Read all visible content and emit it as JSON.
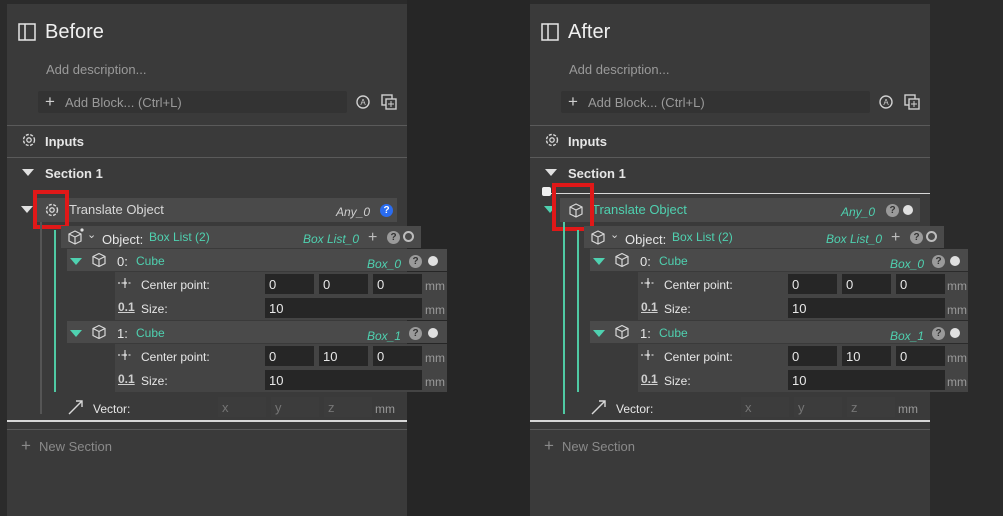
{
  "before": {
    "title": "Before",
    "description_placeholder": "Add description...",
    "add_block": "Add Block... (Ctrl+L)",
    "inputs": "Inputs",
    "section": "Section 1",
    "block_name": "Translate Object",
    "block_type": "Any_0",
    "object_label": "Object:",
    "object_value": "Box List (2)",
    "object_type": "Box List_0",
    "items": [
      {
        "index": "0:",
        "name": "Cube",
        "type": "Box_0",
        "center_label": "Center point:",
        "center": [
          "0",
          "0",
          "0"
        ],
        "size_label": "Size:",
        "size": "10",
        "unit": "mm"
      },
      {
        "index": "1:",
        "name": "Cube",
        "type": "Box_1",
        "center_label": "Center point:",
        "center": [
          "0",
          "10",
          "0"
        ],
        "size_label": "Size:",
        "size": "10",
        "unit": "mm"
      }
    ],
    "vector_label": "Vector:",
    "vector_placeholders": [
      "x",
      "y",
      "z"
    ],
    "vector_unit": "mm",
    "new_section": "New Section"
  },
  "after": {
    "title": "After",
    "description_placeholder": "Add description...",
    "add_block": "Add Block... (Ctrl+L)",
    "inputs": "Inputs",
    "section": "Section 1",
    "block_name": "Translate Object",
    "block_type": "Any_0",
    "object_label": "Object:",
    "object_value": "Box List (2)",
    "object_type": "Box List_0",
    "items": [
      {
        "index": "0:",
        "name": "Cube",
        "type": "Box_0",
        "center_label": "Center point:",
        "center": [
          "0",
          "0",
          "0"
        ],
        "size_label": "Size:",
        "size": "10",
        "unit": "mm"
      },
      {
        "index": "1:",
        "name": "Cube",
        "type": "Box_1",
        "center_label": "Center point:",
        "center": [
          "0",
          "10",
          "0"
        ],
        "size_label": "Size:",
        "size": "10",
        "unit": "mm"
      }
    ],
    "vector_label": "Vector:",
    "vector_placeholders": [
      "x",
      "y",
      "z"
    ],
    "vector_unit": "mm",
    "new_section": "New Section"
  },
  "colors": {
    "accent": "#4fd1b0",
    "highlight": "#e01818",
    "info": "#2a6cf0"
  }
}
